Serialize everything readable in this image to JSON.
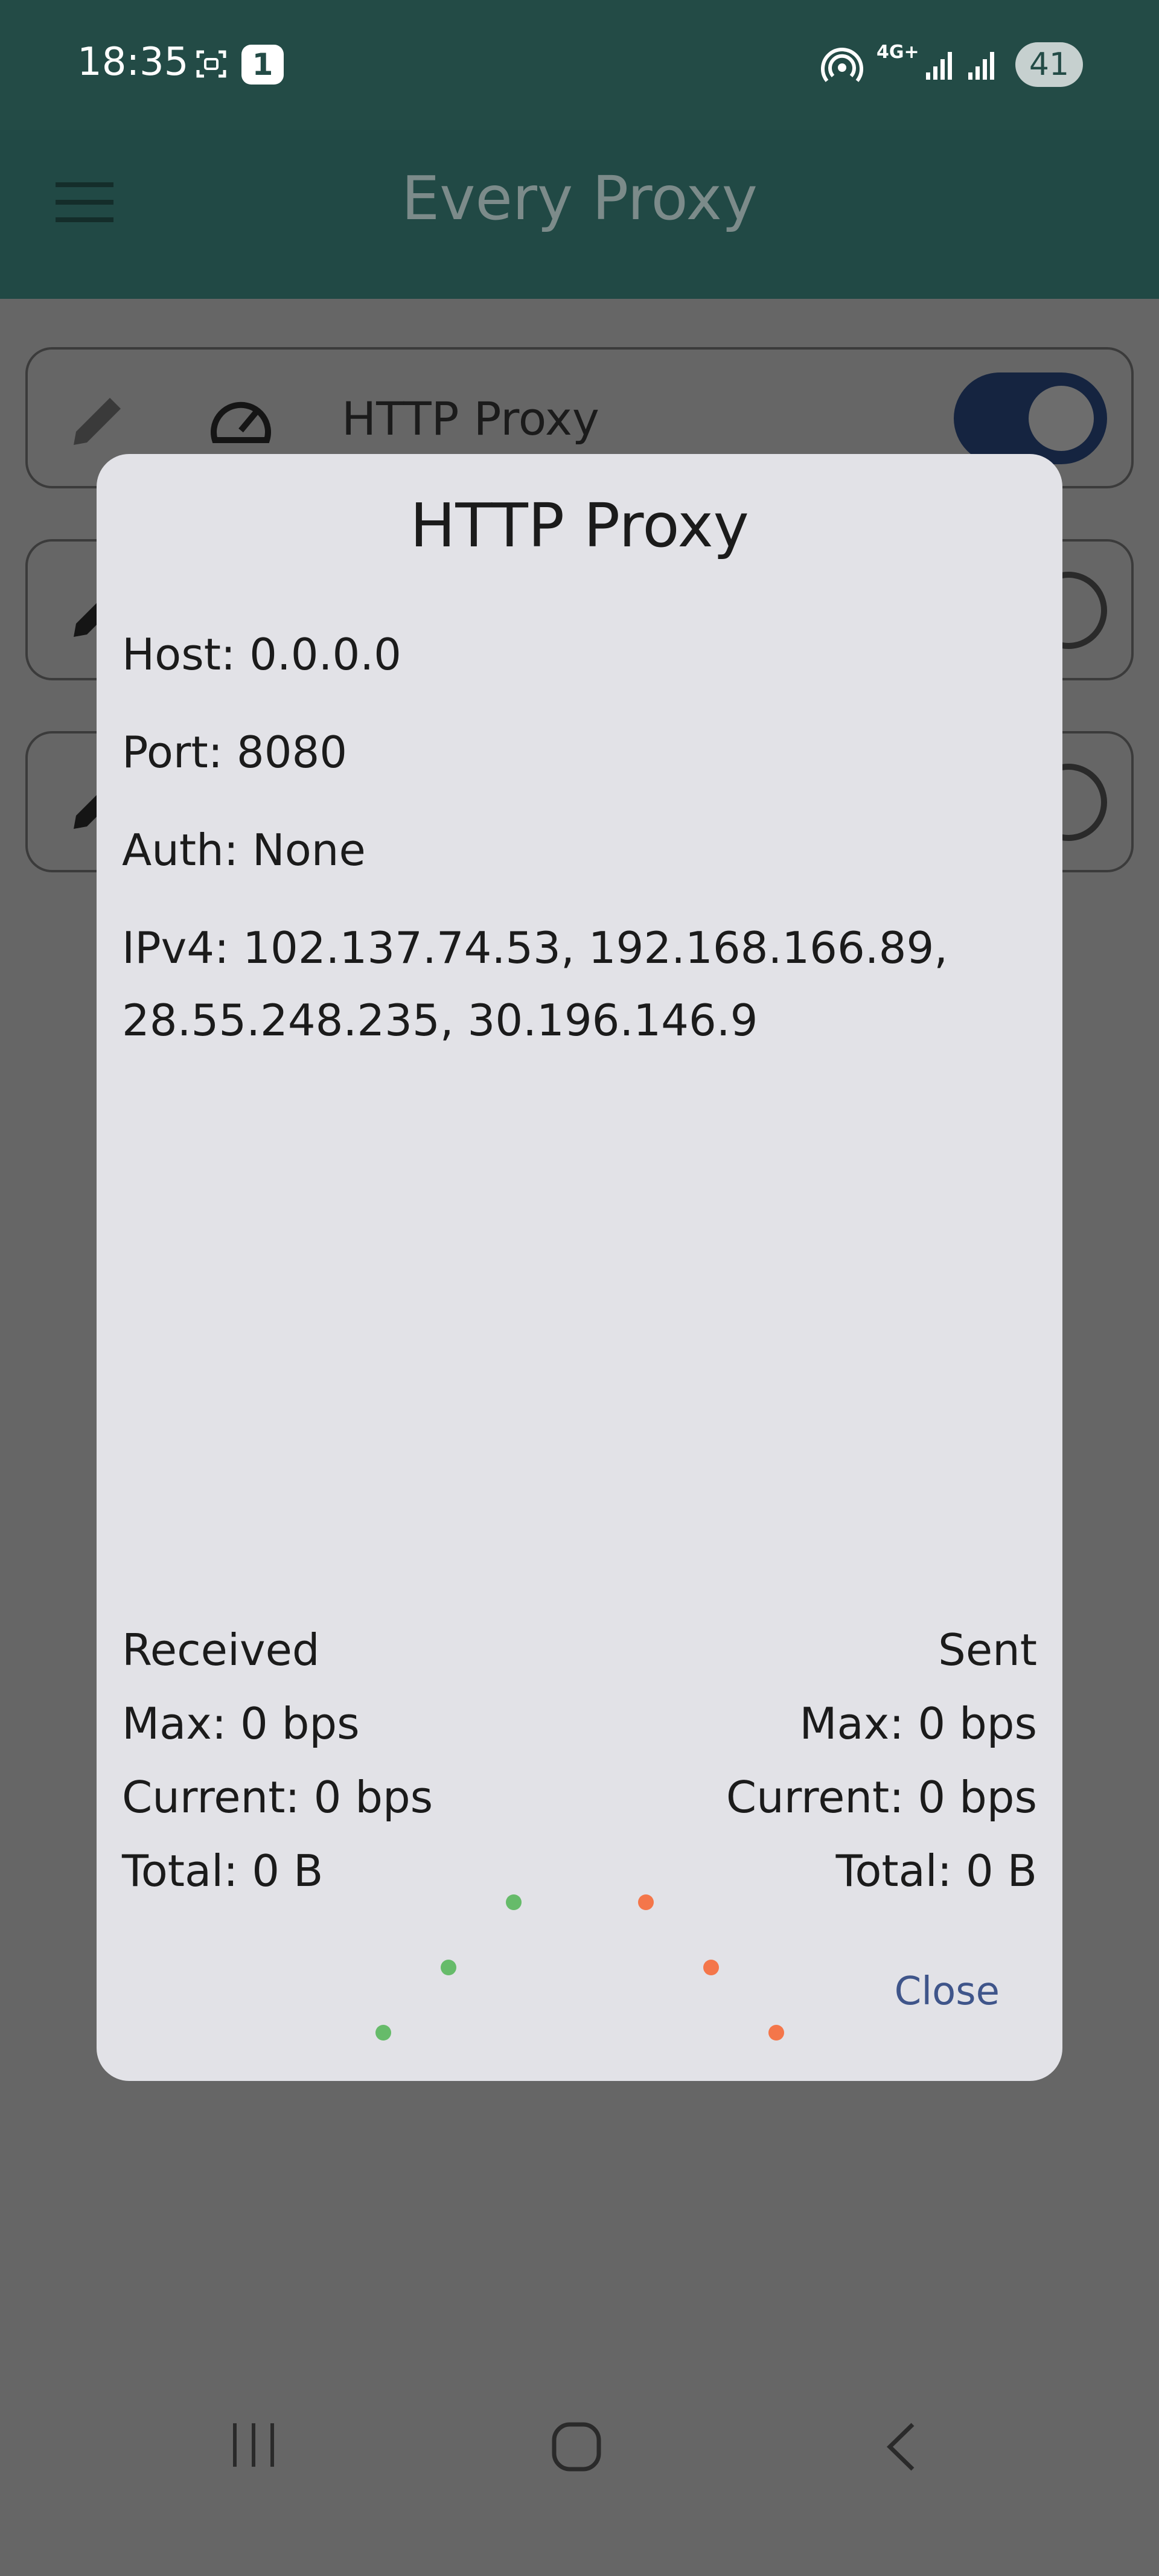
{
  "status_bar": {
    "time": "18:35",
    "notification_count": "1",
    "network_type": "4G+",
    "battery": "41"
  },
  "app_bar": {
    "title": "Every Proxy"
  },
  "proxy_list": [
    {
      "label": "HTTP Proxy",
      "enabled": true
    },
    {
      "label": "",
      "enabled": false
    },
    {
      "label": "",
      "enabled": false
    }
  ],
  "dialog": {
    "title": "HTTP Proxy",
    "host": "Host: 0.0.0.0",
    "port": "Port: 8080",
    "auth": "Auth: None",
    "ipv4_line1": "IPv4: 102.137.74.53, 192.168.166.89,",
    "ipv4_line2": "28.55.248.235, 30.196.146.9",
    "received": {
      "heading": "Received",
      "max": "Max: 0 bps",
      "current": "Current: 0 bps",
      "total": "Total: 0 B"
    },
    "sent": {
      "heading": "Sent",
      "max": "Max: 0 bps",
      "current": "Current: 0 bps",
      "total": "Total: 0 B"
    },
    "close_label": "Close"
  },
  "chart_data": {
    "type": "scatter",
    "series": [
      {
        "name": "Received",
        "color": "#66bb6a",
        "values": [
          0,
          1,
          2
        ]
      },
      {
        "name": "Sent",
        "color": "#f4764a",
        "values": [
          2,
          1,
          0
        ]
      }
    ]
  },
  "colors": {
    "app_bar": "#214945",
    "toggle_on": "#152440",
    "received": "#66bb6a",
    "sent": "#f4764a",
    "accent": "#3f558a"
  }
}
